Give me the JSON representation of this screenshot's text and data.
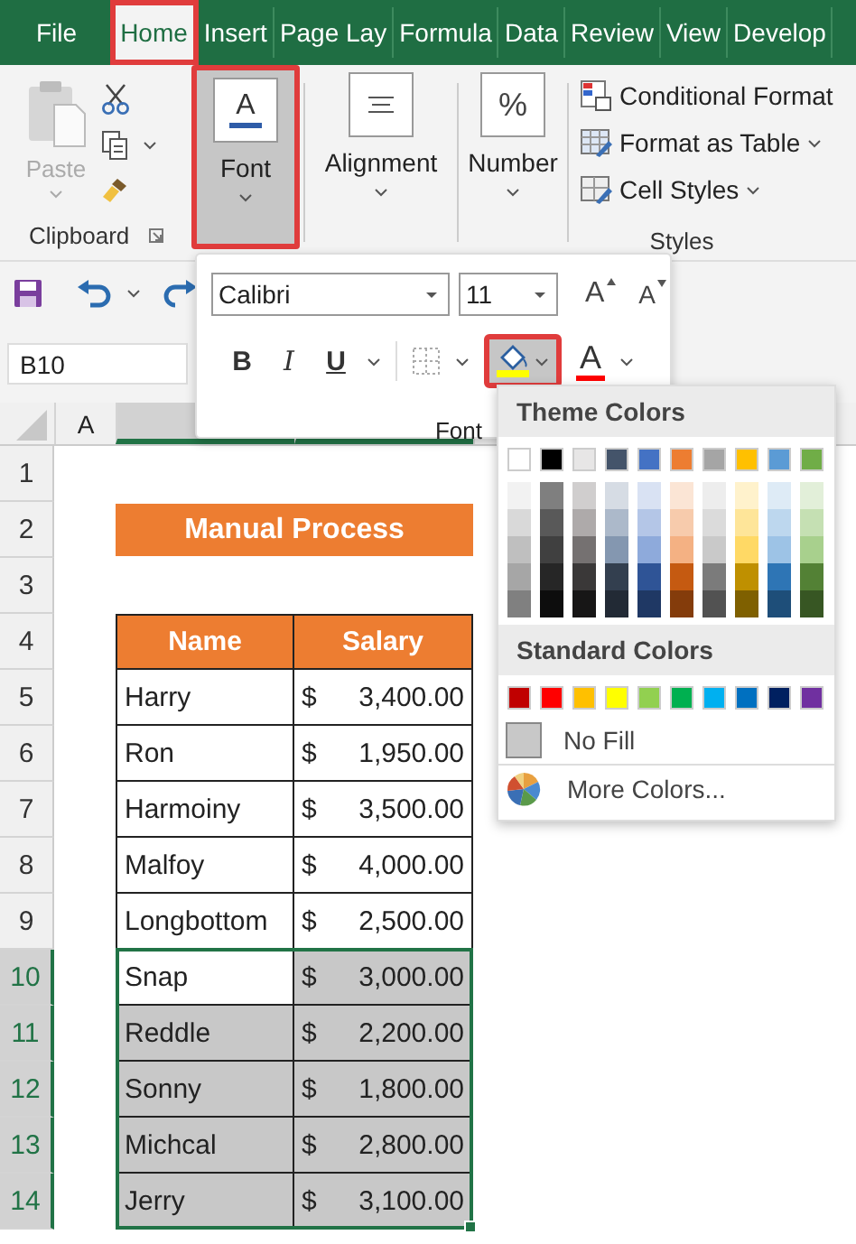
{
  "ribbon_tabs": [
    {
      "label": "File",
      "selected": false
    },
    {
      "label": "Home",
      "selected": true
    },
    {
      "label": "Insert",
      "selected": false
    },
    {
      "label": "Page Lay",
      "selected": false
    },
    {
      "label": "Formula",
      "selected": false
    },
    {
      "label": "Data",
      "selected": false
    },
    {
      "label": "Review",
      "selected": false
    },
    {
      "label": "View",
      "selected": false
    },
    {
      "label": "Develop",
      "selected": false
    }
  ],
  "clipboard": {
    "paste_label": "Paste",
    "label": "Clipboard"
  },
  "ribbon_groups": [
    {
      "kind": "font",
      "label": "Font",
      "glyph": "A",
      "selected": true
    },
    {
      "kind": "alignment",
      "label": "Alignment",
      "selected": false
    },
    {
      "kind": "number",
      "label": "Number",
      "glyph": "%",
      "selected": false
    }
  ],
  "styles": {
    "items": [
      {
        "kind": "conditional",
        "label": "Conditional Format",
        "caret": false
      },
      {
        "kind": "table",
        "label": "Format as Table",
        "caret": true
      },
      {
        "kind": "cell",
        "label": "Cell Styles",
        "caret": true
      }
    ],
    "label": "Styles"
  },
  "font_popup": {
    "font_name": "Calibri",
    "font_size": "11",
    "grow_glyph": "A",
    "shrink_glyph": "A",
    "bold": "B",
    "italic": "I",
    "underline": "U",
    "fill_selected": true,
    "font_color_glyph": "A",
    "label": "Font"
  },
  "name_box": "B10",
  "columns": [
    {
      "label": "A",
      "selected": false
    },
    {
      "selected": true
    },
    {
      "selected": true
    },
    {
      "selected": false
    }
  ],
  "rows": [
    {
      "number": "1",
      "selected": false,
      "kind": "blank"
    },
    {
      "number": "2",
      "selected": false,
      "kind": "title",
      "text": "Manual Process"
    },
    {
      "number": "3",
      "selected": false,
      "kind": "blank"
    },
    {
      "number": "4",
      "selected": false,
      "kind": "header",
      "name": "Name",
      "salary": "Salary"
    },
    {
      "number": "5",
      "selected": false,
      "kind": "data",
      "name": "Harry",
      "currency": "$",
      "amount": "3,400.00",
      "name_shaded": false,
      "salary_shaded": false
    },
    {
      "number": "6",
      "selected": false,
      "kind": "data",
      "name": "Ron",
      "currency": "$",
      "amount": "1,950.00",
      "name_shaded": false,
      "salary_shaded": false
    },
    {
      "number": "7",
      "selected": false,
      "kind": "data",
      "name": "Harmoiny",
      "currency": "$",
      "amount": "3,500.00",
      "name_shaded": false,
      "salary_shaded": false
    },
    {
      "number": "8",
      "selected": false,
      "kind": "data",
      "name": "Malfoy",
      "currency": "$",
      "amount": "4,000.00",
      "name_shaded": false,
      "salary_shaded": false
    },
    {
      "number": "9",
      "selected": false,
      "kind": "data",
      "name": "Longbottom",
      "currency": "$",
      "amount": "2,500.00",
      "name_shaded": false,
      "salary_shaded": false
    },
    {
      "number": "10",
      "selected": true,
      "kind": "data",
      "name": "Snap",
      "currency": "$",
      "amount": "3,000.00",
      "name_shaded": false,
      "salary_shaded": true
    },
    {
      "number": "11",
      "selected": true,
      "kind": "data",
      "name": "Reddle",
      "currency": "$",
      "amount": "2,200.00",
      "name_shaded": true,
      "salary_shaded": true
    },
    {
      "number": "12",
      "selected": true,
      "kind": "data",
      "name": "Sonny",
      "currency": "$",
      "amount": "1,800.00",
      "name_shaded": true,
      "salary_shaded": true
    },
    {
      "number": "13",
      "selected": true,
      "kind": "data",
      "name": "Michcal",
      "currency": "$",
      "amount": "2,800.00",
      "name_shaded": true,
      "salary_shaded": true
    },
    {
      "number": "14",
      "selected": true,
      "kind": "data",
      "name": "Jerry",
      "currency": "$",
      "amount": "3,100.00",
      "name_shaded": true,
      "salary_shaded": true
    }
  ],
  "color_menu": {
    "theme_title": "Theme Colors",
    "theme": [
      {
        "color": "#ffffff",
        "shades": [
          {
            "color": "#f2f2f2"
          },
          {
            "color": "#d9d9d9"
          },
          {
            "color": "#bfbfbf"
          },
          {
            "color": "#a6a6a6"
          },
          {
            "color": "#808080"
          }
        ]
      },
      {
        "color": "#000000",
        "shades": [
          {
            "color": "#7f7f7f"
          },
          {
            "color": "#595959"
          },
          {
            "color": "#404040"
          },
          {
            "color": "#262626"
          },
          {
            "color": "#0d0d0d"
          }
        ]
      },
      {
        "color": "#e7e6e6",
        "shades": [
          {
            "color": "#d0cece"
          },
          {
            "color": "#aeaaaa"
          },
          {
            "color": "#757171"
          },
          {
            "color": "#3a3838"
          },
          {
            "color": "#171616"
          }
        ]
      },
      {
        "color": "#44546a",
        "shades": [
          {
            "color": "#d6dce4"
          },
          {
            "color": "#acb9ca"
          },
          {
            "color": "#8497b0"
          },
          {
            "color": "#333f4f"
          },
          {
            "color": "#222a35"
          }
        ]
      },
      {
        "color": "#4472c4",
        "shades": [
          {
            "color": "#d9e2f3"
          },
          {
            "color": "#b4c6e7"
          },
          {
            "color": "#8eaadb"
          },
          {
            "color": "#2f5496"
          },
          {
            "color": "#1f3864"
          }
        ]
      },
      {
        "color": "#ed7d31",
        "shades": [
          {
            "color": "#fbe5d5"
          },
          {
            "color": "#f7cbac"
          },
          {
            "color": "#f4b183"
          },
          {
            "color": "#c55a11"
          },
          {
            "color": "#843c0b"
          }
        ]
      },
      {
        "color": "#a5a5a5",
        "shades": [
          {
            "color": "#ededed"
          },
          {
            "color": "#dbdbdb"
          },
          {
            "color": "#c9c9c9"
          },
          {
            "color": "#7b7b7b"
          },
          {
            "color": "#525252"
          }
        ]
      },
      {
        "color": "#ffc000",
        "shades": [
          {
            "color": "#fff2cc"
          },
          {
            "color": "#fee599"
          },
          {
            "color": "#ffd965"
          },
          {
            "color": "#bf9000"
          },
          {
            "color": "#7f6000"
          }
        ]
      },
      {
        "color": "#5b9bd5",
        "shades": [
          {
            "color": "#deebf6"
          },
          {
            "color": "#bdd7ee"
          },
          {
            "color": "#9dc3e6"
          },
          {
            "color": "#2e75b5"
          },
          {
            "color": "#1e4e79"
          }
        ]
      },
      {
        "color": "#70ad47",
        "shades": [
          {
            "color": "#e2efd9"
          },
          {
            "color": "#c5e0b3"
          },
          {
            "color": "#a8d08d"
          },
          {
            "color": "#538135"
          },
          {
            "color": "#375623"
          }
        ]
      }
    ],
    "standard_title": "Standard Colors",
    "standard": [
      {
        "color": "#c00000"
      },
      {
        "color": "#ff0000"
      },
      {
        "color": "#ffc000"
      },
      {
        "color": "#ffff00"
      },
      {
        "color": "#92d050"
      },
      {
        "color": "#00b050"
      },
      {
        "color": "#00b0f0"
      },
      {
        "color": "#0070c0"
      },
      {
        "color": "#002060"
      },
      {
        "color": "#7030a0"
      }
    ],
    "no_fill": "No Fill",
    "more_colors": "More Colors..."
  }
}
